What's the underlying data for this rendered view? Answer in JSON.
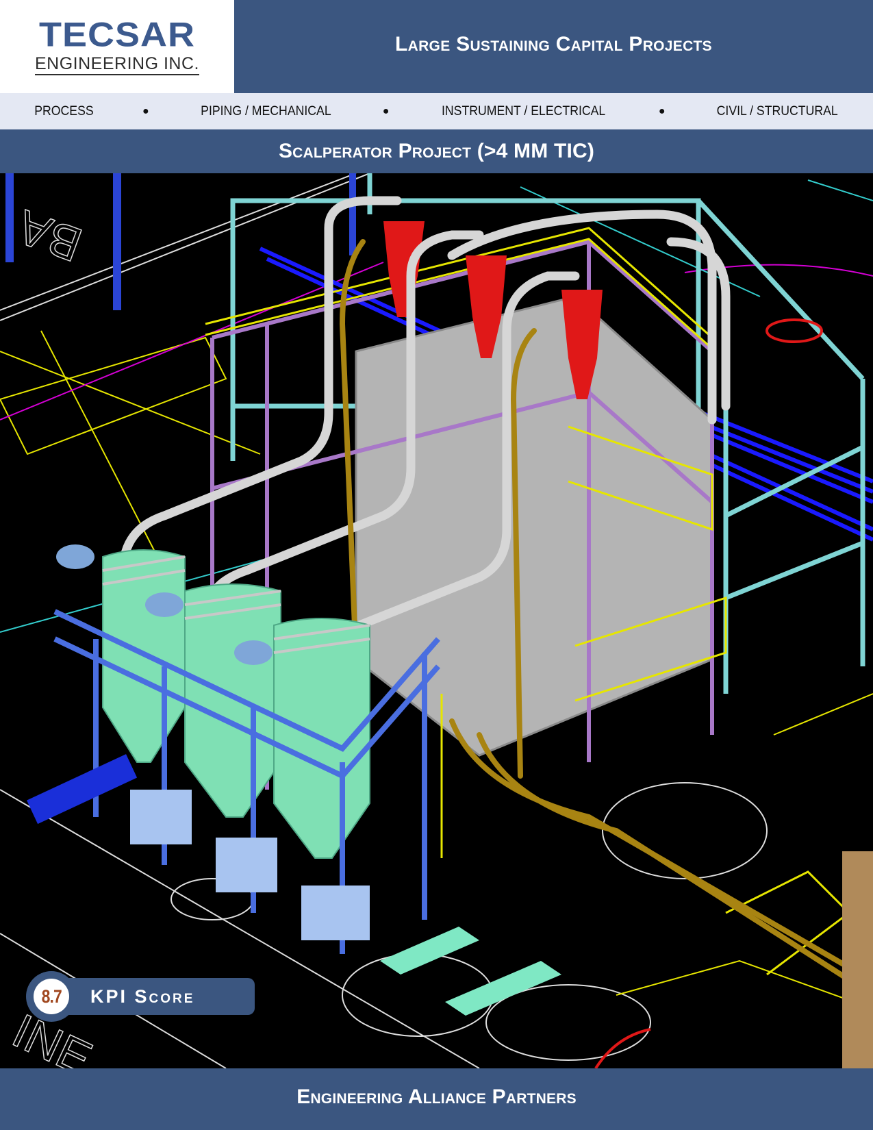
{
  "logo": {
    "main": "TECSAR",
    "sub": "ENGINEERING INC."
  },
  "header": {
    "title": "Large Sustaining Capital Projects"
  },
  "disciplines": [
    "PROCESS",
    "PIPING / MECHANICAL",
    "INSTRUMENT / ELECTRICAL",
    "CIVIL / STRUCTURAL"
  ],
  "project": {
    "title": "Scalperator Project (>4 MM TIC)"
  },
  "kpi": {
    "score": "8.7",
    "label": "KPI Score"
  },
  "footer": {
    "title": "Engineering Alliance Partners"
  },
  "colors": {
    "brand_blue": "#3b5680",
    "logo_blue": "#3c5a8e",
    "disc_bar": "#e4e8f3",
    "kpi_value": "#a0471f"
  }
}
